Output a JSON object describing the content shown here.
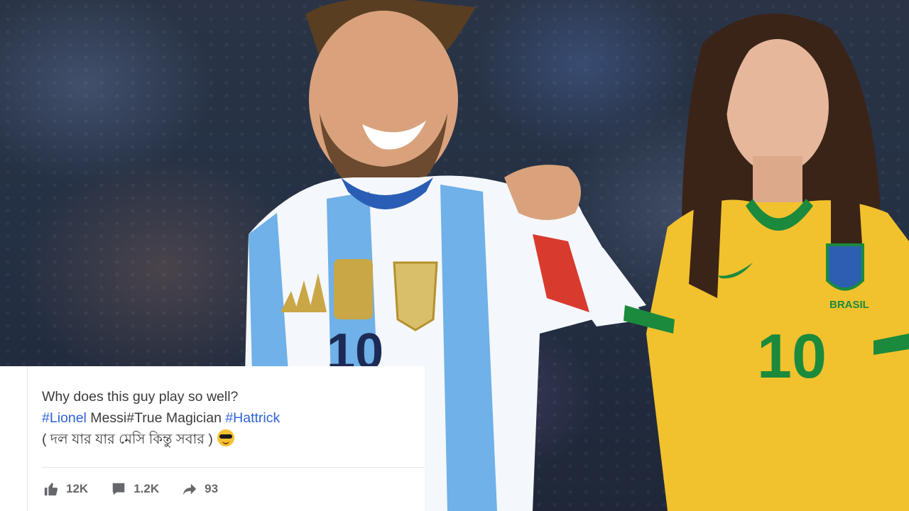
{
  "post": {
    "line1": "Why does this guy play so well?",
    "hashtag1": "#Lionel",
    "text_mid": " Messi",
    "hashtag2": "#True",
    "text_mid2": " Magician ",
    "hashtag3": "#Hattrick",
    "line3": "( দল যার যার মেসি কিন্তু সবার )",
    "emoji": "sunglasses-emoji"
  },
  "actions": {
    "likes": "12K",
    "comments": "1.2K",
    "shares": "93"
  },
  "jersey_right": {
    "brand": "BRASIL",
    "number": "10"
  },
  "jersey_left": {
    "number": "10"
  },
  "colors": {
    "hashtag": "#2d62d6",
    "argentina_blue": "#6fb1e8",
    "brazil_yellow": "#f2c12e",
    "brazil_green": "#1b8a3c"
  }
}
